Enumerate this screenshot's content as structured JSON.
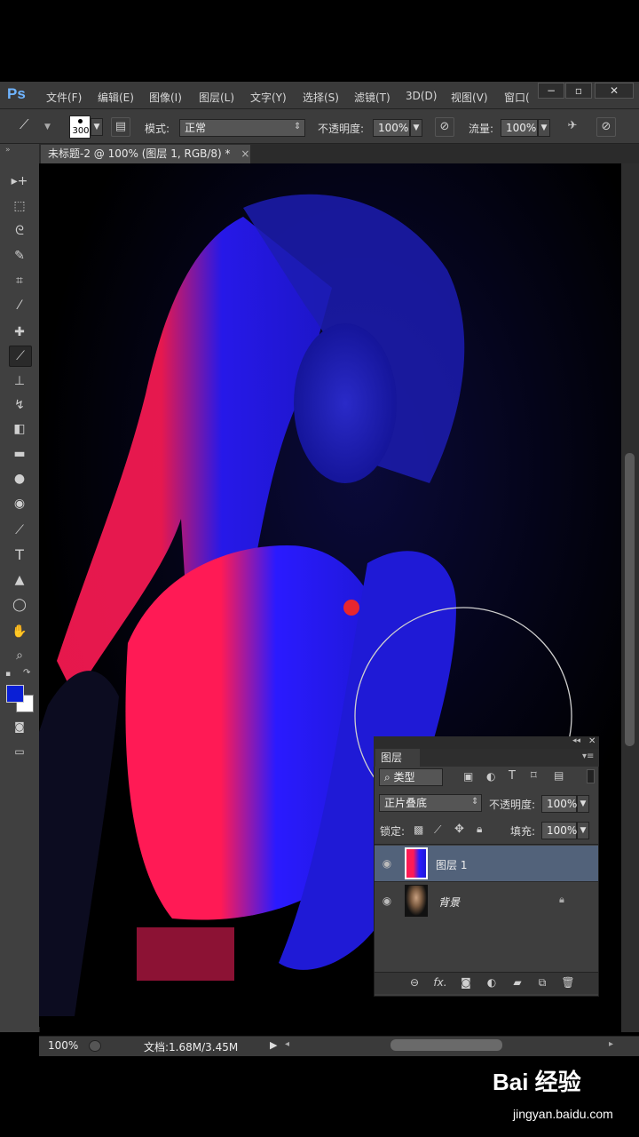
{
  "app": {
    "logo": "Ps"
  },
  "menu": [
    "文件(F)",
    "编辑(E)",
    "图像(I)",
    "图层(L)",
    "文字(Y)",
    "选择(S)",
    "滤镜(T)",
    "3D(D)",
    "视图(V)",
    "窗口("
  ],
  "window_controls": {
    "minimize": "−",
    "restore": "▫",
    "close": "✕"
  },
  "options": {
    "brush_size": "300",
    "mode_label": "模式:",
    "mode_value": "正常",
    "opacity_label": "不透明度:",
    "opacity_value": "100%",
    "flow_label": "流量:",
    "flow_value": "100%"
  },
  "document_tab": {
    "title": "未标题-2 @ 100% (图层 1, RGB/8) *",
    "close": "×"
  },
  "tools": [
    {
      "icon": "move-icon",
      "glyph": "▸+"
    },
    {
      "icon": "marquee-icon",
      "glyph": "⬚"
    },
    {
      "icon": "lasso-icon",
      "glyph": "ᘓ"
    },
    {
      "icon": "quick-select-icon",
      "glyph": "✎"
    },
    {
      "icon": "crop-icon",
      "glyph": "⌗"
    },
    {
      "icon": "eyedropper-icon",
      "glyph": "⁄"
    },
    {
      "icon": "healing-icon",
      "glyph": "✚"
    },
    {
      "icon": "brush-icon",
      "glyph": "⟋"
    },
    {
      "icon": "stamp-icon",
      "glyph": "⊥"
    },
    {
      "icon": "history-brush-icon",
      "glyph": "↯"
    },
    {
      "icon": "eraser-icon",
      "glyph": "◧"
    },
    {
      "icon": "gradient-icon",
      "glyph": "▬"
    },
    {
      "icon": "blur-icon",
      "glyph": "●"
    },
    {
      "icon": "dodge-icon",
      "glyph": "◉"
    },
    {
      "icon": "pen-icon",
      "glyph": "⟋"
    },
    {
      "icon": "type-icon",
      "glyph": "T"
    },
    {
      "icon": "path-select-icon",
      "glyph": "▲"
    },
    {
      "icon": "ellipse-icon",
      "glyph": "◯"
    },
    {
      "icon": "hand-icon",
      "glyph": "✋"
    },
    {
      "icon": "zoom-icon",
      "glyph": "⌕"
    }
  ],
  "colors": {
    "foreground": "#0a1fd6",
    "background": "#ffffff",
    "ui_dark": "#3c3c3c",
    "selected_layer": "#52627a"
  },
  "status": {
    "zoom": "100%",
    "doc": "文档:1.68M/3.45M"
  },
  "layers_panel": {
    "title": "图层",
    "filter_kind": "类型",
    "blend_mode": "正片叠底",
    "opacity_label": "不透明度:",
    "opacity_value": "100%",
    "lock_label": "锁定:",
    "fill_label": "填充:",
    "fill_value": "100%",
    "layers": [
      {
        "name": "图层 1",
        "selected": true
      },
      {
        "name": "背景",
        "selected": false,
        "locked": true
      }
    ]
  },
  "watermark": {
    "brand": "Bai 经验",
    "url": "jingyan.baidu.com"
  }
}
